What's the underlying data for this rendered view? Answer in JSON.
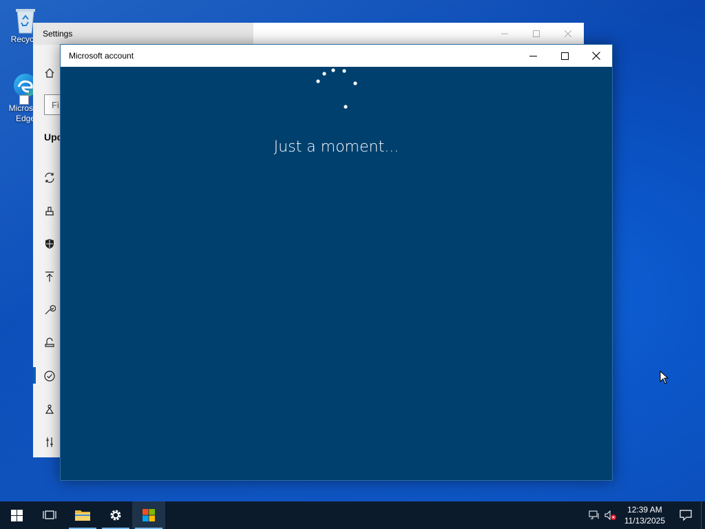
{
  "desktop": {
    "icons": [
      {
        "label": "Recycle",
        "icon": "recycle-bin-icon"
      },
      {
        "label": "Microsoft Edge",
        "icon": "edge-icon"
      }
    ]
  },
  "settings_window": {
    "title": "Settings",
    "search_placeholder": "Fi",
    "section_heading": "Upd",
    "nav_icons": [
      "home-icon",
      "sync-icon",
      "delivery-icon",
      "shield-icon",
      "backup-icon",
      "troubleshoot-icon",
      "recovery-icon",
      "activation-icon",
      "find-device-icon",
      "developer-icon"
    ],
    "controls": [
      "minimize",
      "maximize",
      "close"
    ]
  },
  "ms_account_dialog": {
    "title": "Microsoft account",
    "message": "Just a moment...",
    "controls": {
      "minimize": "minimize-icon",
      "maximize": "maximize-icon",
      "close": "close-icon"
    }
  },
  "taskbar": {
    "buttons": [
      {
        "name": "start",
        "icon": "windows-logo-icon"
      },
      {
        "name": "task-view",
        "icon": "task-view-icon"
      },
      {
        "name": "file-explorer",
        "icon": "folder-icon"
      },
      {
        "name": "settings",
        "icon": "gear-icon"
      },
      {
        "name": "microsoft-store",
        "icon": "store-icon",
        "active": true
      }
    ],
    "clock_time": "12:39 AM",
    "clock_date": "11/13/2025",
    "tray_icons": [
      "network-icon",
      "volume-muted-icon",
      "notification-icon"
    ]
  },
  "colors": {
    "dialog_bg": "#00406e",
    "taskbar_bg": "#0c1b2c",
    "accent": "#0063b1"
  }
}
